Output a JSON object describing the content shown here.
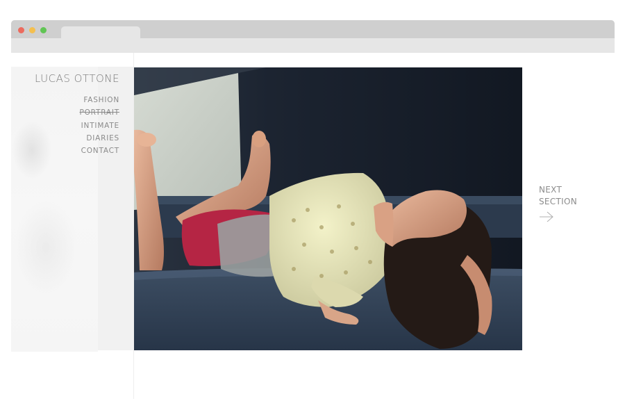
{
  "site": {
    "title": "LUCAS OTTONE"
  },
  "nav": {
    "items": [
      {
        "label": "FASHION",
        "active": false
      },
      {
        "label": "PORTRAIT",
        "active": true
      },
      {
        "label": "INTIMATE",
        "active": false
      },
      {
        "label": "DIARIES",
        "active": false
      },
      {
        "label": "CONTACT",
        "active": false
      }
    ]
  },
  "next": {
    "line1": "NEXT",
    "line2": "SECTION",
    "icon": "arrow-right-icon"
  },
  "hero": {
    "icon": "photo-woman-reclining-on-sofa"
  },
  "colors": {
    "traffic_red": "#ec6b5e",
    "traffic_yellow": "#f4bf4f",
    "traffic_green": "#61c554",
    "text_gray": "#8a8a8a"
  }
}
